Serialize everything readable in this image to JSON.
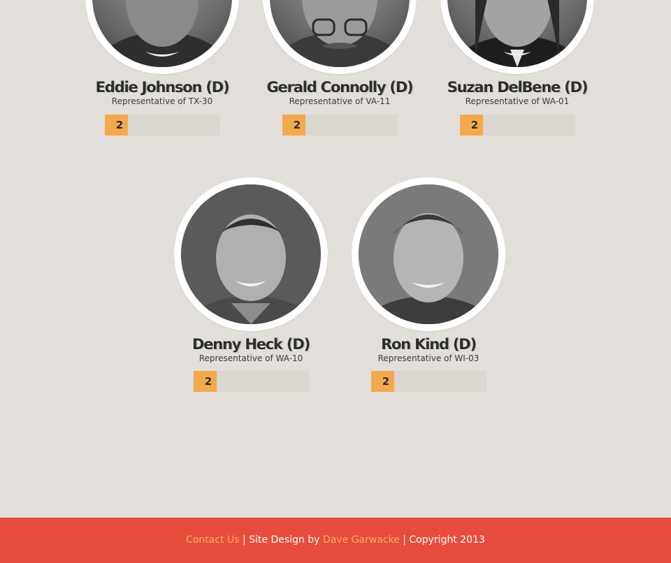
{
  "colors": {
    "page_background": "#e2dfda",
    "accent": "#f5a94e",
    "footer_background": "#e84c3d",
    "footer_link": "#f7b062"
  },
  "representatives": [
    {
      "name": "Eddie Johnson (D)",
      "district": "Representative of TX-30",
      "count": 2,
      "count_fraction": 0.2
    },
    {
      "name": "Gerald Connolly (D)",
      "district": "Representative of VA-11",
      "count": 2,
      "count_fraction": 0.2
    },
    {
      "name": "Suzan DelBene (D)",
      "district": "Representative of WA-01",
      "count": 2,
      "count_fraction": 0.2
    },
    {
      "name": "Denny Heck (D)",
      "district": "Representative of WA-10",
      "count": 2,
      "count_fraction": 0.2
    },
    {
      "name": "Ron Kind (D)",
      "district": "Representative of WI-03",
      "count": 2,
      "count_fraction": 0.2
    }
  ],
  "footer": {
    "contact_label": "Contact Us",
    "separator": " | ",
    "design_prefix": "Site Design by ",
    "designer": "Dave Garwacke",
    "copyright": "Copyright 2013"
  }
}
